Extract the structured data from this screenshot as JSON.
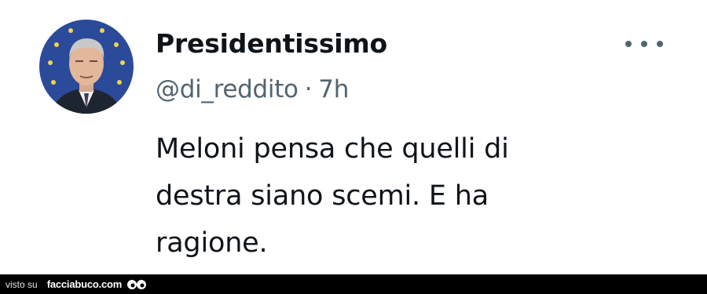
{
  "tweet": {
    "display_name": "Presidentissimo",
    "handle": "@di_reddito",
    "separator": "·",
    "time": "7h",
    "text": "Meloni pensa che quelli di destra siano scemi. E ha ragione.",
    "avatar_icon": "avatar",
    "more_icon": "more-options-icon"
  },
  "footer": {
    "prefix": "visto su",
    "site": "facciabuco.com",
    "logo_icon": "facciabuco-eyes-logo"
  },
  "colors": {
    "text_primary": "#0f1419",
    "text_secondary": "#536471",
    "footer_bg": "#000000"
  }
}
